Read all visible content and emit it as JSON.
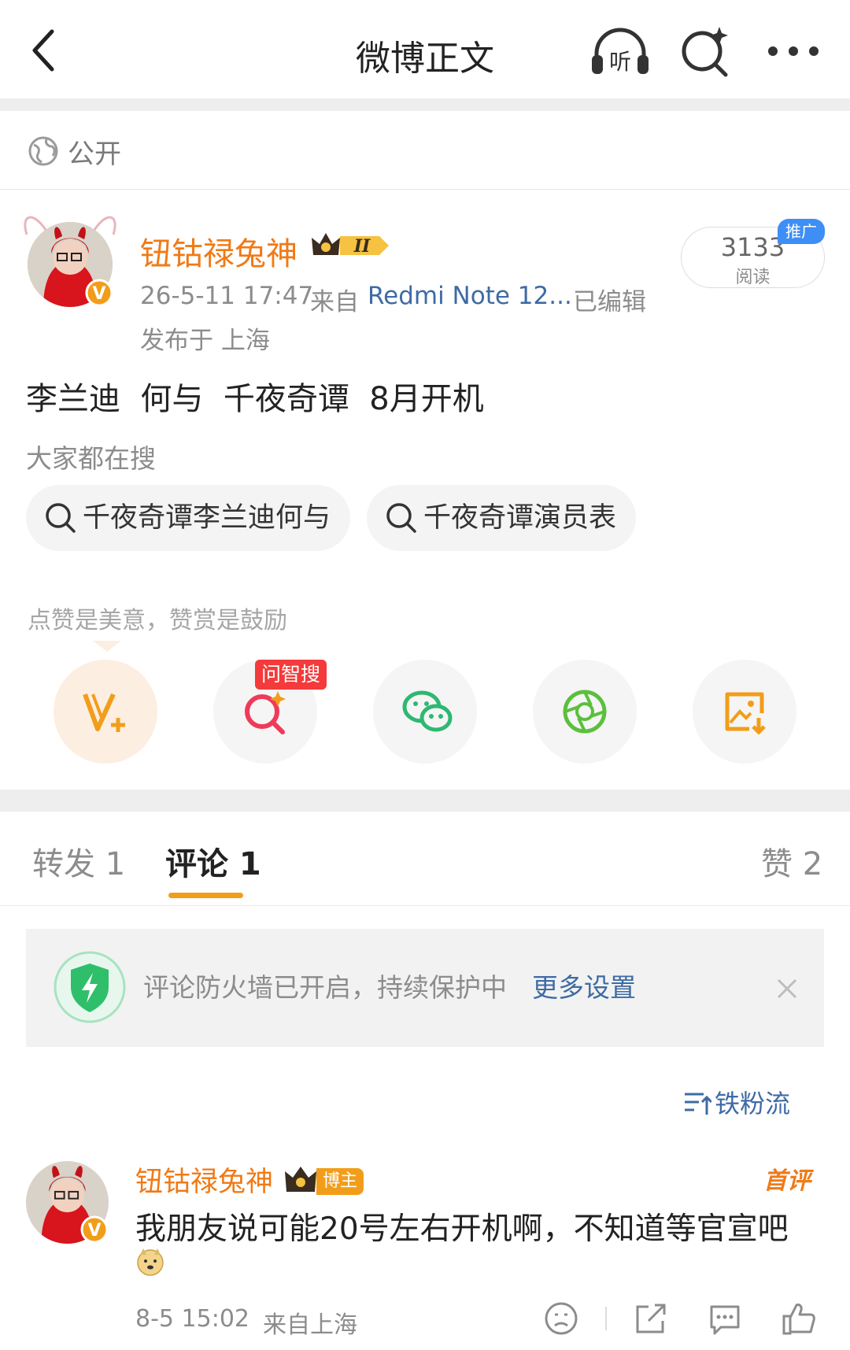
{
  "header": {
    "title": "微博正文",
    "listen_icon_text": "听"
  },
  "visibility": {
    "label": "公开"
  },
  "post": {
    "author": {
      "name": "钮钴禄兔神",
      "level_badge": "II"
    },
    "timestamp": "26-5-11 17:47",
    "source_prefix": "来自",
    "source_device": "Redmi Note 12...",
    "edited": "已编辑",
    "location": "发布于 上海",
    "reads": {
      "count": "3133",
      "label": "阅读",
      "promo": "推广"
    },
    "content": "李兰迪  何与  千夜奇谭  8月开机",
    "search_section_label": "大家都在搜",
    "search_chips": [
      "千夜奇谭李兰迪何与",
      "千夜奇谭演员表"
    ],
    "encourage_text": "点赞是美意，赞赏是鼓励",
    "ai_search_badge": "问智搜"
  },
  "tabs": [
    {
      "label": "转发 1"
    },
    {
      "label": "评论 1"
    },
    {
      "label": "赞 2"
    }
  ],
  "firewall": {
    "text": "评论防火墙已开启，持续保护中",
    "link": "更多设置"
  },
  "sort": {
    "label": "铁粉流"
  },
  "comment": {
    "author": "钮钴禄兔神",
    "owner_badge": "博主",
    "first_badge": "首评",
    "text": "我朋友说可能20号左右开机啊，不知道等官宣吧",
    "time": "8-5 15:02",
    "source": "来自上海"
  },
  "colors": {
    "accent_orange": "#f07a16",
    "link_blue": "#3e6ba4",
    "tab_underline": "#f29d1a",
    "badge_red": "#f43a3a",
    "wechat_green": "#2eb872"
  }
}
